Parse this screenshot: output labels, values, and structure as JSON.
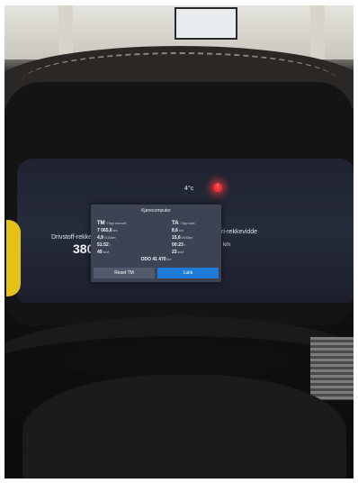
{
  "cluster": {
    "outside_temp": "4°c",
    "left_label": "Drivstoff-rekkevi",
    "left_value": "380",
    "right_label": "ri-rekkevidde",
    "right_sub": "km",
    "warning_color": "#ff2f2f"
  },
  "trip_computer": {
    "title": "Kjørecomputer",
    "left": {
      "code": "TM",
      "name": "Tripp manuell",
      "distance": {
        "value": "7 065,6",
        "unit": "km"
      },
      "consumption": {
        "value": "4,9",
        "unit": "l/100km"
      },
      "time": {
        "value": "51:52",
        "unit": "t"
      },
      "speed": {
        "value": "49",
        "unit": "km/t"
      }
    },
    "right": {
      "code": "TA",
      "name": "Tripp auto",
      "distance": {
        "value": "8,6",
        "unit": "km"
      },
      "consumption": {
        "value": "15,6",
        "unit": "l/100km"
      },
      "time": {
        "value": "00:23",
        "unit": "t"
      },
      "speed": {
        "value": "23",
        "unit": "km/t"
      }
    },
    "odometer": {
      "label": "ODO",
      "value": "41 470",
      "unit": "km"
    },
    "buttons": {
      "reset": "Reset TM",
      "close": "Lukk"
    },
    "accent_color": "#1f7bd8"
  }
}
